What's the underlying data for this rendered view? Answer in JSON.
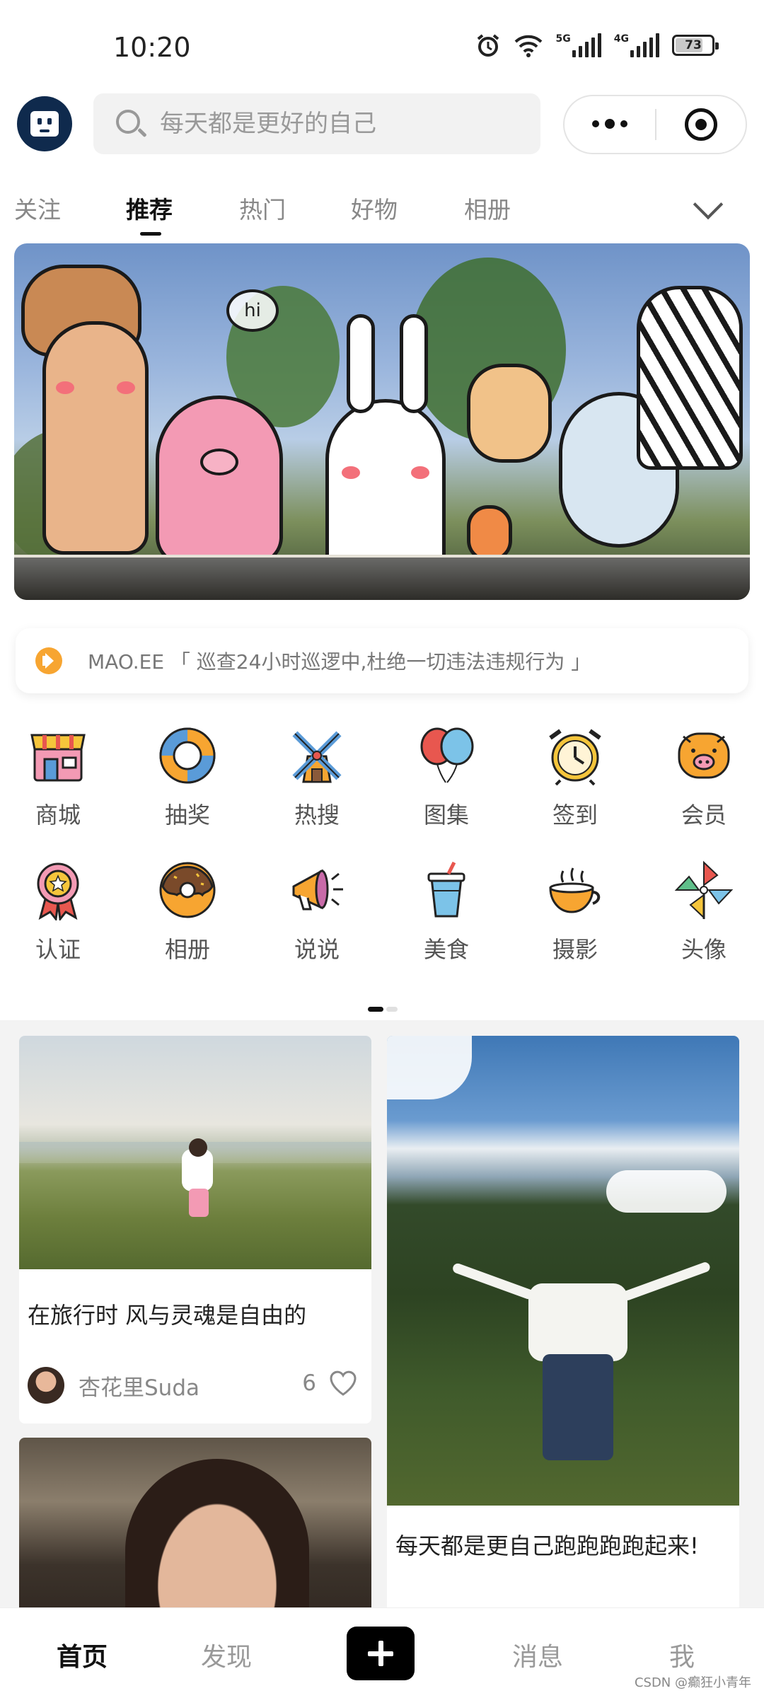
{
  "status_bar": {
    "time": "10:20",
    "battery": "73",
    "net1": "5G",
    "net2": "4G"
  },
  "header": {
    "search_placeholder": "每天都是更好的自己"
  },
  "tabs": [
    {
      "label": "关注",
      "active": false
    },
    {
      "label": "推荐",
      "active": true
    },
    {
      "label": "热门",
      "active": false
    },
    {
      "label": "好物",
      "active": false
    },
    {
      "label": "相册",
      "active": false
    }
  ],
  "banner": {
    "hand_text": "hi"
  },
  "notice": {
    "text": "MAO.EE 「 巡查24小时巡逻中,杜绝一切违法违规行为 」"
  },
  "grid": [
    {
      "label": "商城",
      "icon": "shop-icon"
    },
    {
      "label": "抽奖",
      "icon": "lifebuoy-icon"
    },
    {
      "label": "热搜",
      "icon": "windmill-icon"
    },
    {
      "label": "图集",
      "icon": "balloons-icon"
    },
    {
      "label": "签到",
      "icon": "alarm-clock-icon"
    },
    {
      "label": "会员",
      "icon": "piggy-bank-icon"
    },
    {
      "label": "认证",
      "icon": "medal-icon"
    },
    {
      "label": "相册",
      "icon": "donut-icon"
    },
    {
      "label": "说说",
      "icon": "megaphone-icon"
    },
    {
      "label": "美食",
      "icon": "drink-icon"
    },
    {
      "label": "摄影",
      "icon": "coffee-cup-icon"
    },
    {
      "label": "头像",
      "icon": "pinwheel-icon"
    }
  ],
  "feed": [
    {
      "title": "在旅行时 风与灵魂是自由的",
      "author": "杏花里Suda",
      "likes": "6"
    },
    {
      "title": "每天都是更自己跑跑跑跑起来!"
    }
  ],
  "nav": [
    {
      "label": "首页",
      "active": true
    },
    {
      "label": "发现",
      "active": false
    },
    {
      "label": "消息",
      "active": false
    },
    {
      "label": "我",
      "active": false
    }
  ],
  "watermark": "CSDN @癫狂小青年",
  "colors": {
    "accent": "#f7a531",
    "dark": "#111111",
    "logo_bg": "#0f2a4d"
  }
}
